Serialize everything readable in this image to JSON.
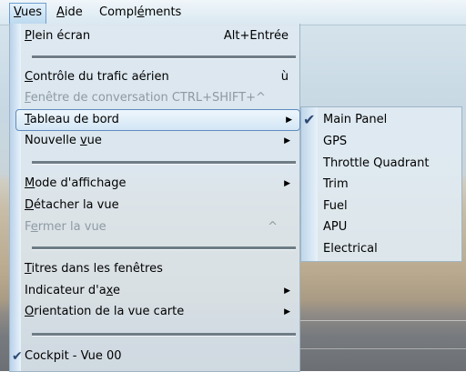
{
  "menubar": {
    "items": [
      {
        "pre": "",
        "mn": "V",
        "post": "ues"
      },
      {
        "pre": "",
        "mn": "A",
        "post": "ide"
      },
      {
        "pre": "Compl",
        "mn": "é",
        "post": "ments"
      }
    ]
  },
  "menu": {
    "plein_ecran": {
      "pre": "",
      "mn": "P",
      "post": "lein écran",
      "shortcut": "Alt+Entrée"
    },
    "controle": {
      "pre": "",
      "mn": "C",
      "post": "ontrôle du trafic aérien",
      "shortcut": "ù"
    },
    "fenetre_conv": {
      "pre": "",
      "mn": "F",
      "post": "enêtre de conversation CTRL+SHIFT+^"
    },
    "tableau": {
      "pre": "",
      "mn": "T",
      "post": "ableau de bord"
    },
    "nouvelle": {
      "pre": "Nouvelle ",
      "mn": "v",
      "post": "ue"
    },
    "mode": {
      "pre": "",
      "mn": "M",
      "post": "ode d'affichage"
    },
    "detacher": {
      "pre": "",
      "mn": "D",
      "post": "étacher la vue"
    },
    "fermer": {
      "pre": "F",
      "mn": "e",
      "post": "rmer la vue",
      "shortcut": "^"
    },
    "titres": {
      "pre": "",
      "mn": "T",
      "post": "itres dans les fenêtres"
    },
    "indicateur": {
      "pre": "Indicateur d'a",
      "mn": "x",
      "post": "e"
    },
    "orientation": {
      "pre": "",
      "mn": "O",
      "post": "rientation de la vue carte"
    },
    "cockpit": {
      "label": "Cockpit - Vue 00"
    }
  },
  "submenu": {
    "items": [
      "Main Panel",
      "GPS",
      "Throttle Quadrant",
      "Trim",
      "Fuel",
      "APU",
      "Electrical"
    ]
  },
  "glyphs": {
    "arrow": "▶",
    "check": "✔"
  },
  "colors": {
    "highlight_border": "#5f8bc0",
    "disabled_text": "#8e9aa3"
  }
}
